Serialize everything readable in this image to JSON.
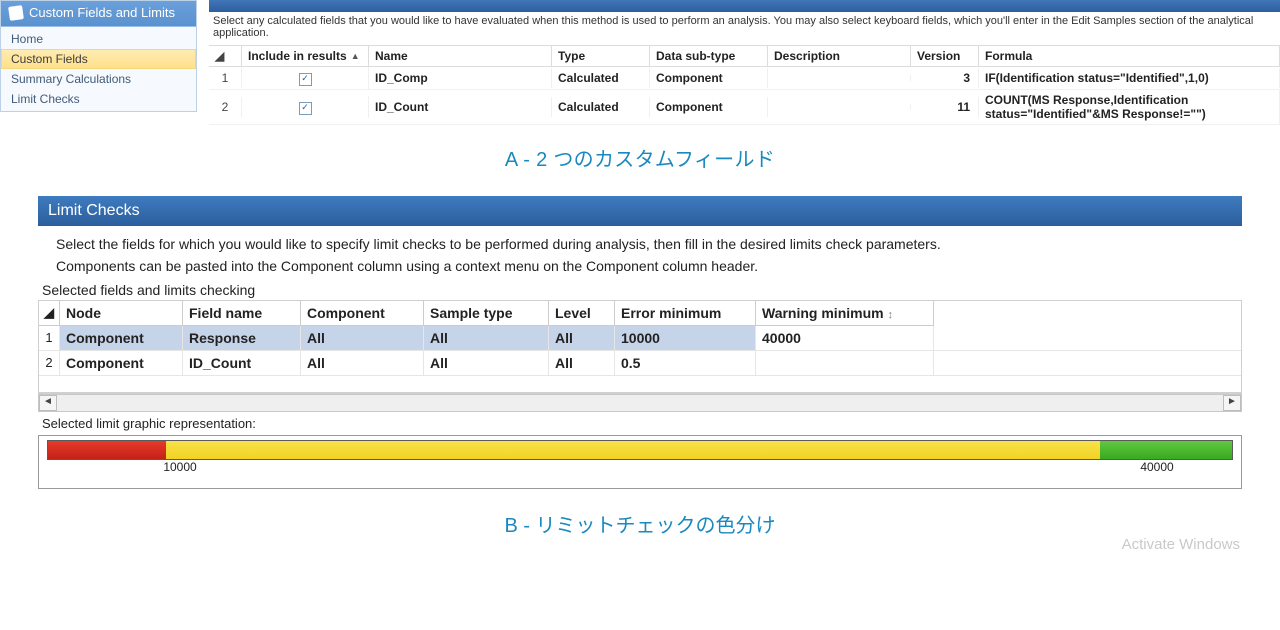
{
  "side": {
    "title": "Custom Fields and Limits",
    "items": [
      {
        "label": "Home"
      },
      {
        "label": "Custom Fields"
      },
      {
        "label": "Summary Calculations"
      },
      {
        "label": "Limit Checks"
      }
    ]
  },
  "topPanel": {
    "instruction": "Select any calculated fields that you would like to have evaluated when this method is used to perform an analysis. You may also select keyboard fields, which you'll enter in the Edit Samples section of the analytical application.",
    "headers": {
      "include": "Include in results",
      "name": "Name",
      "type": "Type",
      "sub": "Data sub-type",
      "desc": "Description",
      "ver": "Version",
      "formula": "Formula"
    },
    "rows": [
      {
        "idx": "1",
        "include": true,
        "name": "ID_Comp",
        "type": "Calculated",
        "sub": "Component",
        "desc": "",
        "ver": "3",
        "formula": "IF(Identification status=\"Identified\",1,0)"
      },
      {
        "idx": "2",
        "include": true,
        "name": "ID_Count",
        "type": "Calculated",
        "sub": "Component",
        "desc": "",
        "ver": "11",
        "formula": "COUNT(MS Response,Identification status=\"Identified\"&MS Response!=\"\")"
      }
    ]
  },
  "captions": {
    "a": "A - 2 つのカスタムフィールド",
    "b": "B - リミットチェックの色分け"
  },
  "limitChecks": {
    "title": "Limit Checks",
    "p1": "Select the fields for which you would like to specify limit checks to be performed during analysis, then fill in the desired limits check parameters.",
    "p2": "Components can be pasted into the Component column using a context menu on the Component column header.",
    "subhead": "Selected fields and limits checking",
    "headers": {
      "node": "Node",
      "field": "Field name",
      "comp": "Component",
      "samp": "Sample type",
      "lvl": "Level",
      "err": "Error minimum",
      "warn": "Warning minimum"
    },
    "rows": [
      {
        "idx": "1",
        "node": "Component",
        "field": "Response",
        "comp": "All",
        "samp": "All",
        "lvl": "All",
        "err": "10000",
        "warn": "40000",
        "selected": true
      },
      {
        "idx": "2",
        "node": "Component",
        "field": "ID_Count",
        "comp": "All",
        "samp": "All",
        "lvl": "All",
        "err": "0.5",
        "warn": "",
        "selected": false
      }
    ],
    "repLabel": "Selected limit graphic representation:",
    "tickLow": "10000",
    "tickHigh": "40000"
  },
  "watermark": "Activate Windows"
}
